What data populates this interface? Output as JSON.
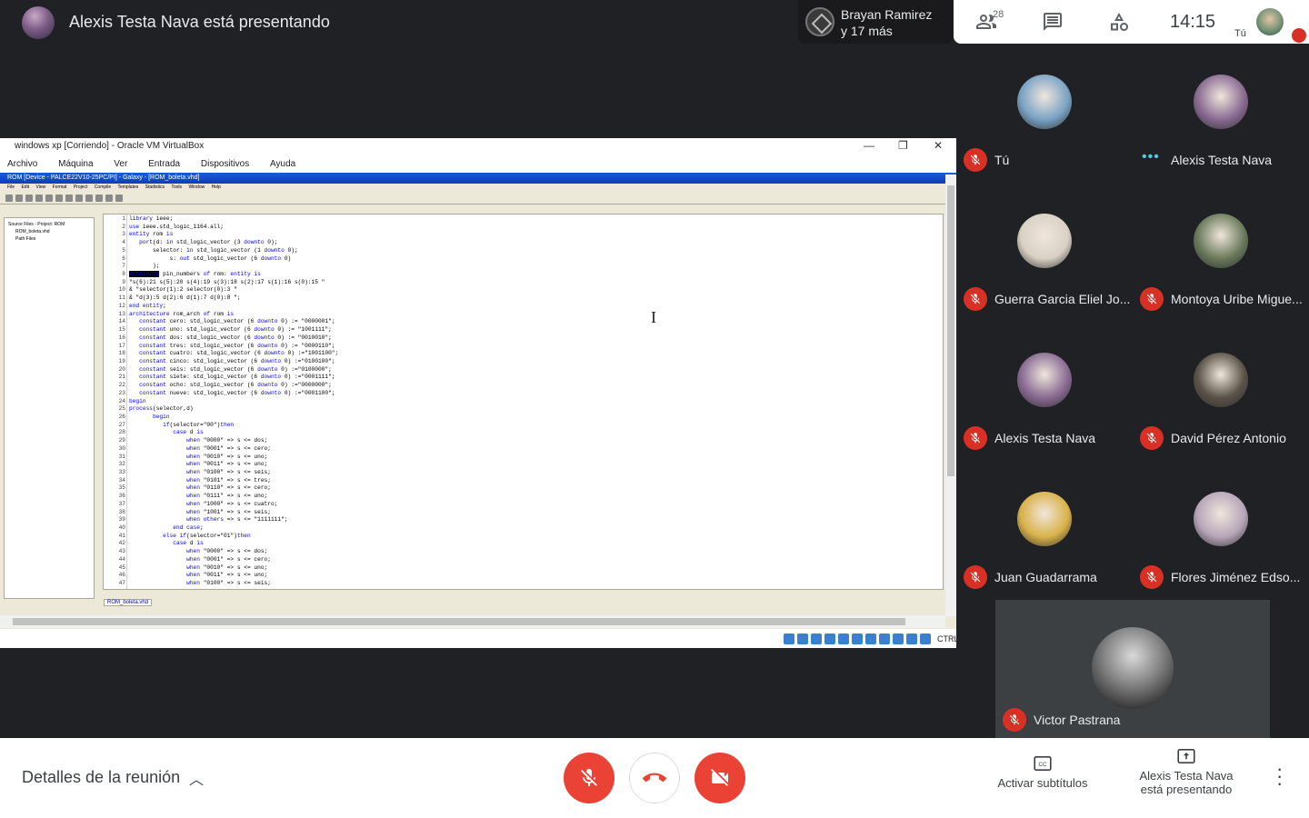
{
  "presenter_bar": {
    "text": "Alexis Testa Nava está presentando"
  },
  "speaker": {
    "line1": "Brayan Ramirez",
    "line2": "y 17 más"
  },
  "top_right": {
    "people_count": "28",
    "clock": "14:15",
    "me_label": "Tú"
  },
  "shared_screen": {
    "vbox_title": "windows xp [Corriendo] - Oracle VM VirtualBox",
    "vbox_menu": [
      "Archivo",
      "Máquina",
      "Ver",
      "Entrada",
      "Dispositivos",
      "Ayuda"
    ],
    "app_title": "ROM [Device - PALCE22V10-25PC/PI] - Galaxy - [ROM_boleta.vhd]",
    "app_menu": [
      "File",
      "Edit",
      "View",
      "Format",
      "Project",
      "Compile",
      "Templates",
      "Stadistics",
      "Tools",
      "Window",
      "Help"
    ],
    "tree_items": [
      "Source Files - Project: ROM",
      "ROM_boleta.vhd",
      "Path Files"
    ],
    "editor_tab": "ROM_boleta.vhd",
    "host_key": "CTRL",
    "code_lines": [
      "library ieee;",
      "use ieee.std_logic_1164.all;",
      "entity rom is",
      "   port(d: in std_logic_vector (3 downto 0);",
      "       selector: in std_logic_vector (1 downto 0);",
      "            s: out std_logic_vector (6 downto 0)",
      "       );",
      "attribute pin_numbers of rom: entity is",
      "\"s(6):21 s(5):20 s(4):19 s(3):18 s(2):17 s(1):16 s(0):15 \"",
      "& \"selector(1):2 selector(0):3 \"",
      "& \"d(3):5 d(2):6 d(1):7 d(0):8 \";",
      "end entity;",
      "architecture rom_arch of rom is",
      "   constant cero: std_logic_vector (6 downto 0) := \"0000001\";",
      "   constant uno: std_logic_vector (6 downto 0) := \"1001111\";",
      "   constant dos: std_logic_vector (6 downto 0) := \"0010010\";",
      "   constant tres: std_logic_vector (6 downto 0) := \"0000110\";",
      "   constant cuatro: std_logic_vector (6 downto 0) :=\"1001100\";",
      "   constant cinco: std_logic_vector (6 downto 0) :=\"0100100\";",
      "   constant seis: std_logic_vector (6 downto 0) :=\"0100000\";",
      "   constant siete: std_logic_vector (6 downto 0) :=\"0001111\";",
      "   constant ocho: std_logic_vector (6 downto 0) :=\"0000000\";",
      "   constant nueve: std_logic_vector (6 downto 0) :=\"0001100\";",
      "begin",
      "process(selector,d)",
      "       begin",
      "          if(selector=\"00\")then",
      "             case d is",
      "                 when \"0000\" => s <= dos;",
      "                 when \"0001\" => s <= cero;",
      "                 when \"0010\" => s <= uno;",
      "                 when \"0011\" => s <= uno;",
      "                 when \"0100\" => s <= seis;",
      "                 when \"0101\" => s <= tres;",
      "                 when \"0110\" => s <= cero;",
      "                 when \"0111\" => s <= uno;",
      "                 when \"1000\" => s <= cuatro;",
      "                 when \"1001\" => s <= seis;",
      "                 when others => s <= \"1111111\";",
      "             end case;",
      "          else if(selector=\"01\")then",
      "             case d is",
      "                 when \"0000\" => s <= dos;",
      "                 when \"0001\" => s <= cero;",
      "                 when \"0010\" => s <= uno;",
      "                 when \"0011\" => s <= uno;",
      "                 when \"0100\" => s <= seis;"
    ]
  },
  "participants": [
    {
      "name": "Tú",
      "muted": true,
      "avatar_color": "#7aa3c4"
    },
    {
      "name": "Alexis Testa Nava",
      "muted": false,
      "speaking": true,
      "avatar_color": "#8a6b93"
    },
    {
      "name": "Guerra Garcia Eliel Jo...",
      "muted": true,
      "avatar_color": "#d9d1c4"
    },
    {
      "name": "Montoya Uribe Migue...",
      "muted": true,
      "avatar_color": "#6a7a5a"
    },
    {
      "name": "Alexis Testa Nava",
      "muted": true,
      "avatar_color": "#8a6b93"
    },
    {
      "name": "David Pérez Antonio",
      "muted": true,
      "avatar_color": "#5a5348"
    },
    {
      "name": "Juan Guadarrama",
      "muted": true,
      "avatar_color": "#d9b24a"
    },
    {
      "name": "Flores Jiménez Edso...",
      "muted": true,
      "avatar_color": "#b7a6b9"
    }
  ],
  "featured_participant": {
    "name": "Victor Pastrana",
    "muted": true
  },
  "bottom_bar": {
    "details_label": "Detalles de la reunión",
    "captions_label": "Activar subtítulos",
    "presenting_line1": "Alexis Testa Nava",
    "presenting_line2": "está presentando"
  },
  "colors": {
    "danger": "#ea4335",
    "mute_badge": "#d93025",
    "background": "#202124",
    "speaking_dots": "#4ecde6"
  }
}
